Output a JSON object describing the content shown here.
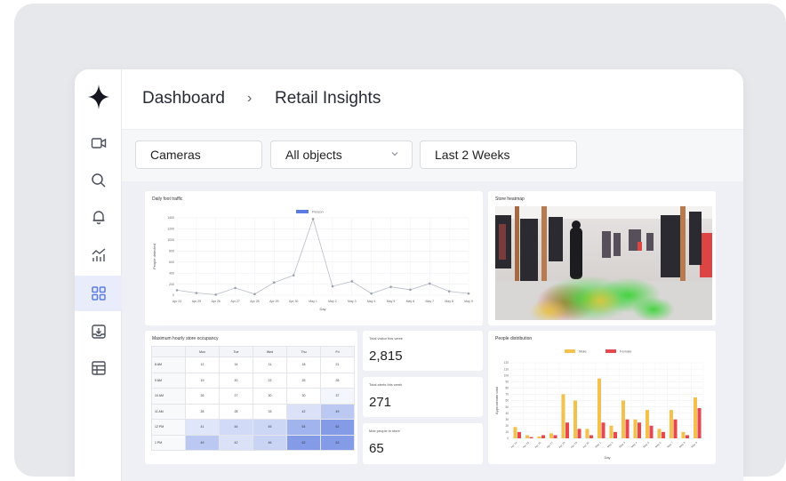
{
  "breadcrumb": {
    "root": "Dashboard",
    "separator": "›",
    "current": "Retail Insights"
  },
  "filters": {
    "cameras": "Cameras",
    "objects": "All objects",
    "range": "Last 2 Weeks"
  },
  "sidebar": {
    "items": [
      {
        "name": "camera-icon"
      },
      {
        "name": "search-icon"
      },
      {
        "name": "bell-icon"
      },
      {
        "name": "analytics-icon"
      },
      {
        "name": "dashboard-grid-icon",
        "active": true
      },
      {
        "name": "inbox-download-icon"
      },
      {
        "name": "table-icon"
      }
    ]
  },
  "colors": {
    "accent": "#5b7be0",
    "active_bg": "#e9edfb",
    "male": "#f2c14e",
    "female": "#e5484d"
  },
  "traffic": {
    "title": "Daily foot traffic",
    "chart_data": {
      "type": "line",
      "title": "Daily foot traffic",
      "xlabel": "Day",
      "ylabel": "People detected",
      "legend": [
        "Person"
      ],
      "categories": [
        "Apr 24",
        "Apr 25",
        "Apr 26",
        "Apr 27",
        "Apr 28",
        "Apr 29",
        "Apr 30",
        "May 1",
        "May 2",
        "May 3",
        "May 4",
        "May 5",
        "May 6",
        "May 7",
        "May 8",
        "May 9"
      ],
      "yticks": [
        "0",
        "200",
        "400",
        "600",
        "800",
        "1000",
        "1200",
        "1400"
      ],
      "ylim": [
        0,
        1400
      ],
      "series": [
        {
          "name": "Person",
          "values": [
            90,
            40,
            10,
            130,
            20,
            230,
            360,
            1380,
            160,
            250,
            30,
            150,
            100,
            210,
            70,
            30
          ]
        }
      ]
    }
  },
  "heatmap": {
    "title": "Store heatmap"
  },
  "occupancy": {
    "title": "Maximum hourly store occupancy",
    "columns": [
      "",
      "Mon",
      "Tue",
      "Wed",
      "Thu",
      "Fri"
    ],
    "rows": [
      {
        "label": "8 AM",
        "values": [
          "12",
          "14",
          "11",
          "18",
          "21"
        ]
      },
      {
        "label": "9 AM",
        "values": [
          "19",
          "20",
          "22",
          "25",
          "26"
        ]
      },
      {
        "label": "10 AM",
        "values": [
          "26",
          "27",
          "30",
          "30",
          "37"
        ]
      },
      {
        "label": "11 AM",
        "values": [
          "28",
          "28",
          "33",
          "42",
          "49"
        ]
      },
      {
        "label": "12 PM",
        "values": [
          "41",
          "44",
          "45",
          "54",
          "62"
        ]
      },
      {
        "label": "1 PM",
        "values": [
          "49",
          "42",
          "46",
          "62",
          "63"
        ]
      }
    ]
  },
  "stats": [
    {
      "label": "Total visitor this week",
      "value": "2,815"
    },
    {
      "label": "Total alerts this week",
      "value": "271"
    },
    {
      "label": "Max people in store",
      "value": "65"
    }
  ],
  "gender": {
    "title": "People distribution",
    "chart_data": {
      "type": "bar",
      "title": "People distribution",
      "xlabel": "Day",
      "ylabel": "Approximate total",
      "ylim": [
        0,
        120
      ],
      "yticks": [
        "0",
        "10",
        "20",
        "30",
        "40",
        "50",
        "60",
        "70",
        "80",
        "90",
        "100",
        "110",
        "120"
      ],
      "categories": [
        "Apr 24",
        "Apr 25",
        "Apr 26",
        "Apr 27",
        "Apr 28",
        "Apr 29",
        "Apr 30",
        "May 1",
        "May 2",
        "May 3",
        "May 4",
        "May 5",
        "May 6",
        "May 7",
        "May 8",
        "May 9"
      ],
      "series": [
        {
          "name": "Male",
          "values": [
            18,
            5,
            3,
            8,
            70,
            60,
            15,
            95,
            20,
            60,
            30,
            45,
            15,
            45,
            10,
            65
          ]
        },
        {
          "name": "Female",
          "values": [
            10,
            2,
            5,
            5,
            25,
            15,
            5,
            25,
            10,
            30,
            25,
            20,
            10,
            30,
            5,
            48
          ]
        }
      ]
    }
  }
}
